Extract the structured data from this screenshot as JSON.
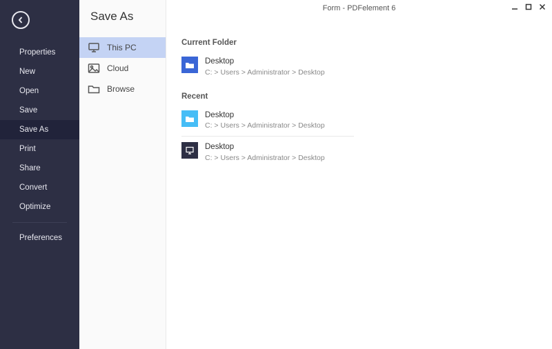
{
  "titlebar": {
    "title": "Form - PDFelement 6"
  },
  "sidebar": {
    "items": [
      {
        "label": "Properties",
        "selected": false
      },
      {
        "label": "New",
        "selected": false
      },
      {
        "label": "Open",
        "selected": false
      },
      {
        "label": "Save",
        "selected": false
      },
      {
        "label": "Save As",
        "selected": true
      },
      {
        "label": "Print",
        "selected": false
      },
      {
        "label": "Share",
        "selected": false
      },
      {
        "label": "Convert",
        "selected": false
      },
      {
        "label": "Optimize",
        "selected": false
      }
    ],
    "preferences_label": "Preferences"
  },
  "secondary": {
    "title": "Save As",
    "locations": [
      {
        "label": "This PC",
        "icon": "monitor-icon",
        "selected": true
      },
      {
        "label": "Cloud",
        "icon": "picture-icon",
        "selected": false
      },
      {
        "label": "Browse",
        "icon": "folder-icon",
        "selected": false
      }
    ]
  },
  "main": {
    "current_folder_label": "Current Folder",
    "recent_label": "Recent",
    "current_folder": {
      "name": "Desktop",
      "path": "C: > Users > Administrator > Desktop",
      "style": "blue",
      "icon": "folder-icon"
    },
    "recent": [
      {
        "name": "Desktop",
        "path": "C: > Users > Administrator > Desktop",
        "style": "lightblue",
        "icon": "folder-icon"
      },
      {
        "name": "Desktop",
        "path": "C: > Users > Administrator > Desktop",
        "style": "dark",
        "icon": "monitor-icon"
      }
    ]
  }
}
